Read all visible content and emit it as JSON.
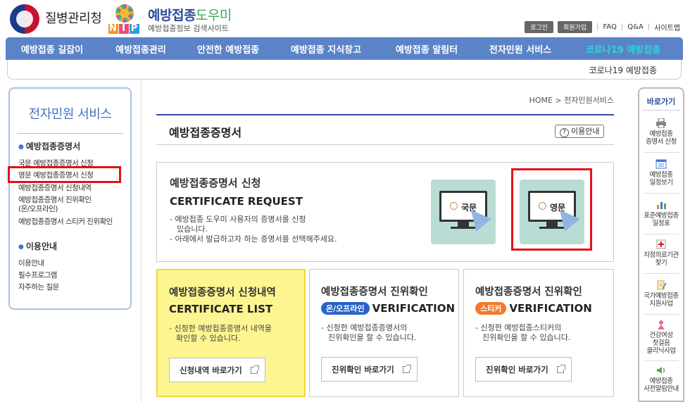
{
  "header": {
    "org_name": "질병관리청",
    "site_name_a": "예방접종",
    "site_name_b": "도우미",
    "site_subtitle": "예방접종정보 검색사이트",
    "nip_letters": [
      "N",
      "I",
      "P"
    ],
    "util": {
      "login": "로그인",
      "join": "회원가입",
      "faq": "FAQ",
      "qna": "Q&A",
      "sitemap": "사이트맵"
    }
  },
  "nav": {
    "items": [
      "예방접종 길잡이",
      "예방접종관리",
      "안전한 예방접종",
      "예방접종 지식창고",
      "예방접종 알림터",
      "전자민원 서비스",
      "코로나19 예방접종"
    ],
    "highlight_color": "#2ad7d7",
    "bar_color": "#5b83c7"
  },
  "subbar": {
    "text": "코로나19 예방접종"
  },
  "sidebar": {
    "title": "전자민원 서비스",
    "section1": "예방접종증명서",
    "items1": [
      "국문 예방접종증명서 신청",
      "영문 예방접종증명서 신청",
      "예방접종증명서 신청내역",
      "예방접종증명서 진위확인",
      "(온/오프라인)",
      "예방접종증명서 스티커 진위확인"
    ],
    "section2": "이용안내",
    "items2": [
      "이용안내",
      "필수프로그램",
      "자주하는 질문"
    ]
  },
  "breadcrumb": "HOME > 전자민원서비스",
  "page": {
    "title": "예방접종증명서",
    "guide_button": "이용안내",
    "guide_icon_glyph": "?"
  },
  "request": {
    "title": "예방접종증명서 신청",
    "en": "CERTIFICATE REQUEST",
    "desc1": "- 예방접종 도우미 사용자의 증명서를 신청",
    "desc1b": "있습니다.",
    "desc2": "- 아래에서 발급하고자 하는 증명서를 선택해주세요.",
    "korean_card": "국문",
    "english_card": "영문"
  },
  "boxes": [
    {
      "title": "예방접종증명서 신청내역",
      "en": "CERTIFICATE LIST",
      "tag": "",
      "desc1": "- 신청한 예방접종증명서 내역을",
      "desc2": "확인할 수 있습니다.",
      "button": "신청내역 바로가기"
    },
    {
      "title": "예방접종증명서 진위확인",
      "en": "VERIFICATION",
      "tag": "온/오프라인",
      "desc1": "- 신청한 예방접종증명서의",
      "desc2": "진위확인을 할 수 있습니다.",
      "button": "진위확인 바로가기"
    },
    {
      "title": "예방접종증명서 진위확인",
      "en": "VERIFICATION",
      "tag": "스티커",
      "desc1": "- 신청한 예방접종스티커의",
      "desc2": "진위확인을 할 수 있습니다.",
      "button": "진위확인 바로가기"
    }
  ],
  "quick": {
    "title": "바로가기",
    "items": [
      [
        "예방접종",
        "증명서 신청"
      ],
      [
        "예방접종",
        "일정보기"
      ],
      [
        "표준예방접종",
        "일정표"
      ],
      [
        "지정의료기관",
        "찾기"
      ],
      [
        "국가예방접종",
        "지원사업"
      ],
      [
        "건강여성",
        "첫걸음",
        "클리닉사업"
      ],
      [
        "예방접종",
        "사전알림안내"
      ]
    ]
  }
}
